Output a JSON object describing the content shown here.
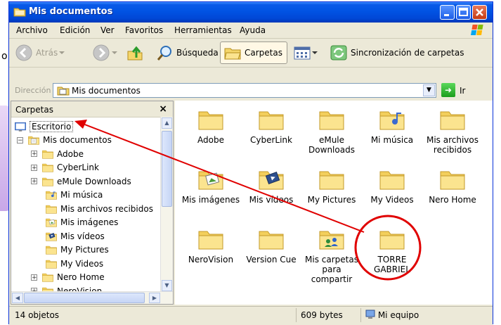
{
  "window": {
    "title": "Mis documentos"
  },
  "menu": [
    "Archivo",
    "Edición",
    "Ver",
    "Favoritos",
    "Herramientas",
    "Ayuda"
  ],
  "toolbar": {
    "back_label": "Atrás",
    "search_label": "Búsqueda",
    "folders_label": "Carpetas",
    "sync_label": "Sincronización de carpetas"
  },
  "address": {
    "label": "Dirección",
    "value": "Mis documentos",
    "go_label": "Ir"
  },
  "folders_pane": {
    "title": "Carpetas",
    "close_glyph": "×",
    "tree": [
      {
        "label": "Escritorio",
        "expander": "",
        "icon": "desktop-icon"
      },
      {
        "label": "Mis documentos",
        "expander": "−",
        "icon": "my-documents-icon"
      },
      {
        "label": "Adobe",
        "expander": "+",
        "icon": "folder-icon"
      },
      {
        "label": "CyberLink",
        "expander": "+",
        "icon": "folder-icon"
      },
      {
        "label": "eMule Downloads",
        "expander": "+",
        "icon": "folder-icon"
      },
      {
        "label": "Mi música",
        "expander": "",
        "icon": "music-folder-icon"
      },
      {
        "label": "Mis archivos recibidos",
        "expander": "",
        "icon": "folder-icon"
      },
      {
        "label": "Mis imágenes",
        "expander": "",
        "icon": "pictures-folder-icon"
      },
      {
        "label": "Mis vídeos",
        "expander": "",
        "icon": "video-folder-icon"
      },
      {
        "label": "My Pictures",
        "expander": "",
        "icon": "folder-icon"
      },
      {
        "label": "My Videos",
        "expander": "",
        "icon": "folder-icon"
      },
      {
        "label": "Nero Home",
        "expander": "+",
        "icon": "folder-icon"
      },
      {
        "label": "NeroVision",
        "expander": "+",
        "icon": "folder-icon"
      }
    ]
  },
  "files": [
    {
      "name": "Adobe",
      "icon": "folder-icon"
    },
    {
      "name": "CyberLink",
      "icon": "folder-icon"
    },
    {
      "name": "eMule Downloads",
      "icon": "folder-icon"
    },
    {
      "name": "Mi música",
      "icon": "music-folder-icon"
    },
    {
      "name": "Mis archivos recibidos",
      "icon": "folder-icon"
    },
    {
      "name": "Mis imágenes",
      "icon": "pictures-folder-icon"
    },
    {
      "name": "Mis vídeos",
      "icon": "video-folder-icon"
    },
    {
      "name": "My Pictures",
      "icon": "folder-icon"
    },
    {
      "name": "My Videos",
      "icon": "folder-icon"
    },
    {
      "name": "Nero Home",
      "icon": "folder-icon"
    },
    {
      "name": "NeroVision",
      "icon": "folder-icon"
    },
    {
      "name": "Version Cue",
      "icon": "folder-icon"
    },
    {
      "name": "Mis carpetas para compartir",
      "icon": "shared-folder-icon"
    },
    {
      "name": "TORRE GABRIEL",
      "icon": "folder-icon"
    }
  ],
  "status": {
    "count": "14 objetos",
    "size": "609 bytes",
    "location": "Mi equipo"
  },
  "colors": {
    "annotation": "#e00000",
    "folder": "#f5d66a",
    "title_bar": "#0153e3"
  }
}
